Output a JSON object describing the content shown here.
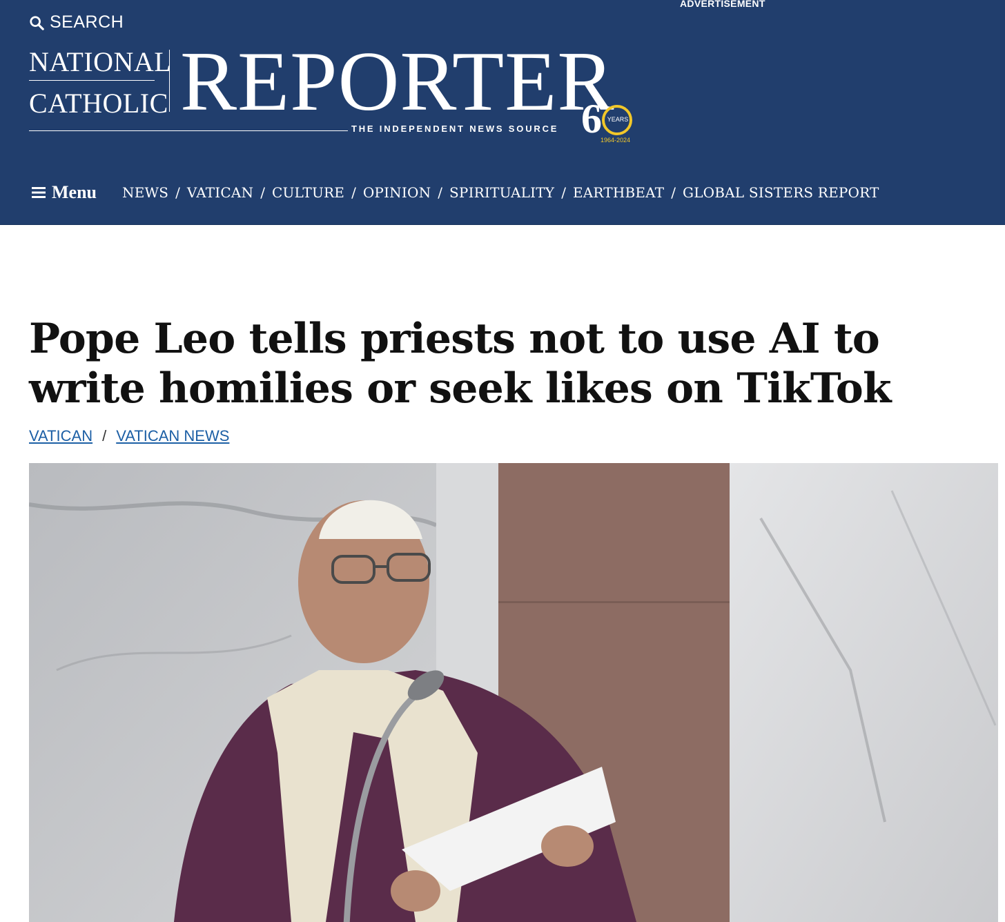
{
  "header": {
    "search_label": "SEARCH",
    "ad_label": "ADVERTISEMENT",
    "logo": {
      "line1": "NATIONAL",
      "line2": "CATHOLIC",
      "name": "REPORTER",
      "tagline": "THE INDEPENDENT NEWS SOURCE",
      "anniversary": {
        "number": "6",
        "years_label": "YEARS",
        "dates": "1964-2024"
      }
    },
    "colors": {
      "navy": "#213e6d",
      "accent_gold": "#f1c72a"
    }
  },
  "nav": {
    "menu_label": "Menu",
    "links": [
      "NEWS",
      "VATICAN",
      "CULTURE",
      "OPINION",
      "SPIRITUALITY",
      "EARTHBEAT",
      "GLOBAL SISTERS REPORT"
    ]
  },
  "article": {
    "headline": "Pope Leo tells priests not to use AI to write homilies or seek likes on TikTok",
    "breadcrumbs": [
      "VATICAN",
      "VATICAN NEWS"
    ],
    "breadcrumb_separator": "/"
  }
}
